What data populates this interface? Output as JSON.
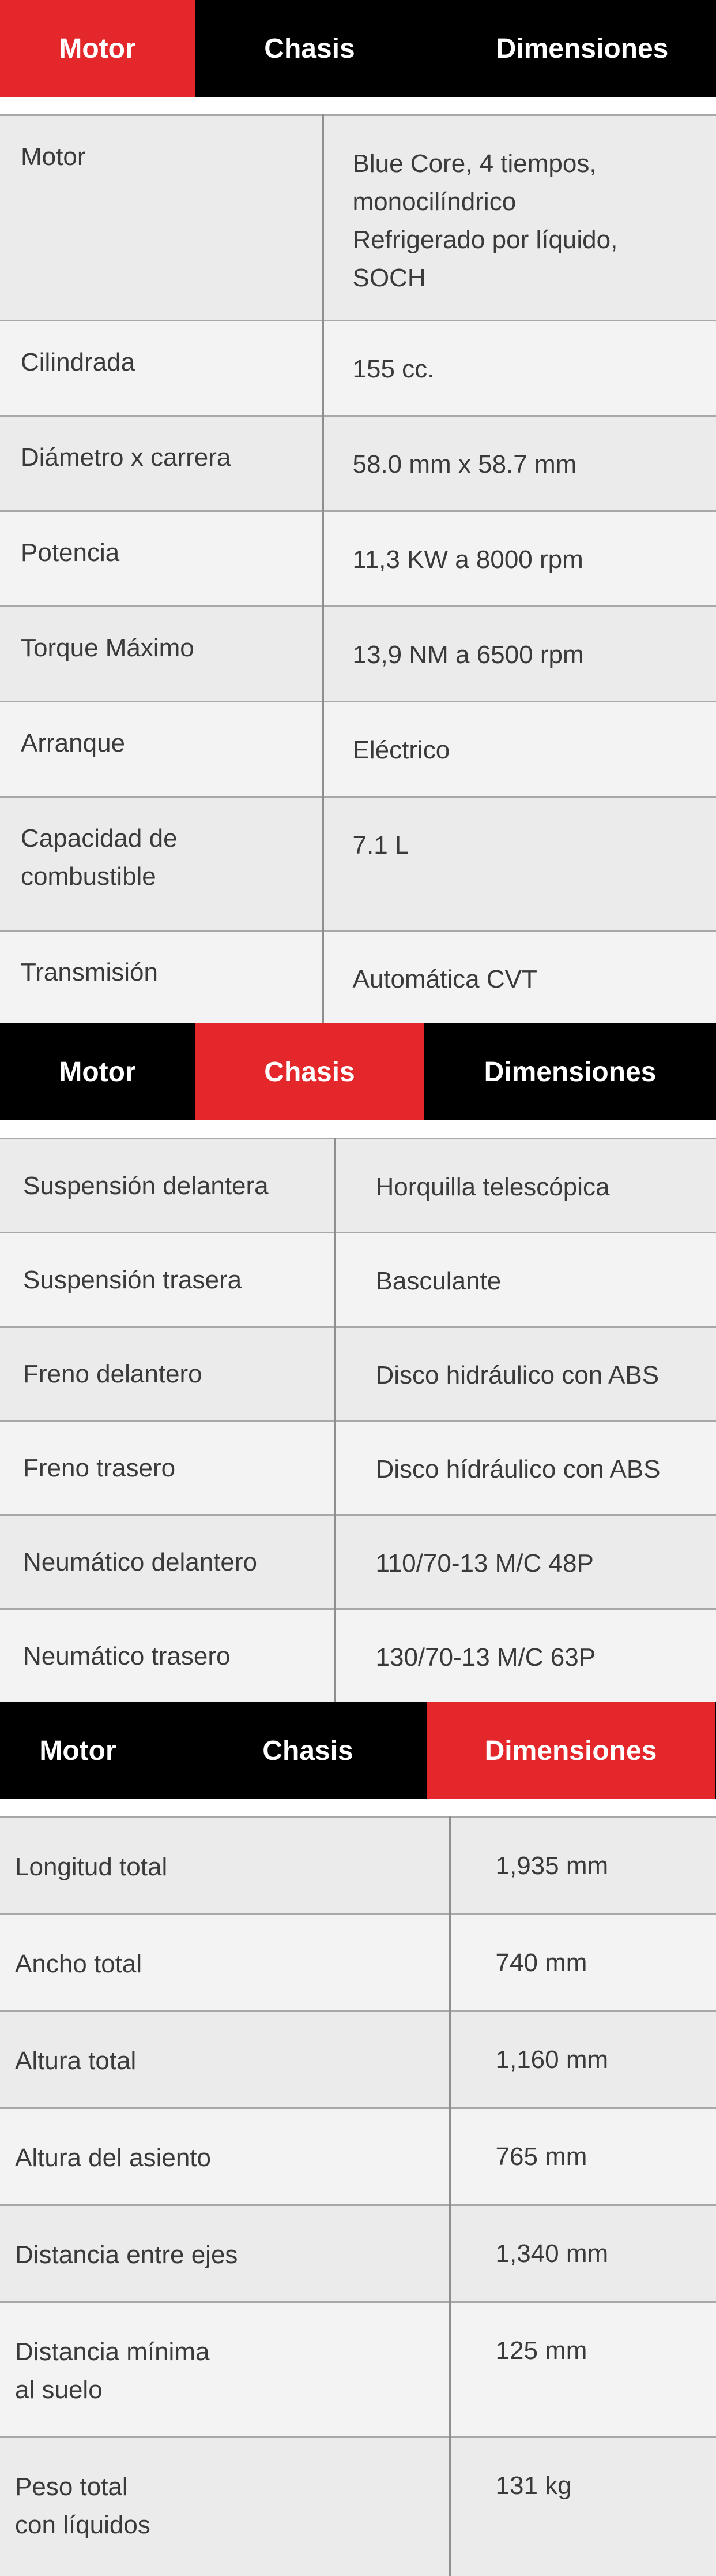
{
  "tabs": [
    "Motor",
    "Chasis",
    "Dimensiones"
  ],
  "sections": {
    "motor": {
      "active_tab": "Motor",
      "rows": [
        {
          "label": "Motor",
          "value": "Blue Core, 4 tiempos,\nmonocilíndrico\nRefrigerado por líquido,\nSOCH"
        },
        {
          "label": "Cilindrada",
          "value": "155 cc."
        },
        {
          "label": "Diámetro x carrera",
          "value": "58.0 mm x 58.7 mm"
        },
        {
          "label": "Potencia",
          "value": "11,3 KW a 8000 rpm"
        },
        {
          "label": "Torque Máximo",
          "value": "13,9 NM a 6500 rpm"
        },
        {
          "label": "Arranque",
          "value": "Eléctrico"
        },
        {
          "label": "Capacidad de\ncombustible",
          "value": "7.1 L"
        },
        {
          "label": "Transmisión",
          "value": "Automática CVT"
        }
      ]
    },
    "chasis": {
      "active_tab": "Chasis",
      "rows": [
        {
          "label": "Suspensión delantera",
          "value": "Horquilla telescópica"
        },
        {
          "label": "Suspensión trasera",
          "value": "Basculante"
        },
        {
          "label": "Freno delantero",
          "value": "Disco hidráulico con ABS"
        },
        {
          "label": "Freno trasero",
          "value": "Disco hídráulico con ABS"
        },
        {
          "label": "Neumático delantero",
          "value": "110/70-13 M/C 48P"
        },
        {
          "label": "Neumático trasero",
          "value": "130/70-13 M/C 63P"
        }
      ]
    },
    "dimensiones": {
      "active_tab": "Dimensiones",
      "rows": [
        {
          "label": "Longitud total",
          "value": "1,935 mm"
        },
        {
          "label": "Ancho total",
          "value": "740 mm"
        },
        {
          "label": "Altura total",
          "value": "1,160 mm"
        },
        {
          "label": "Altura del asiento",
          "value": "765 mm"
        },
        {
          "label": "Distancia entre ejes",
          "value": "1,340 mm"
        },
        {
          "label": "Distancia mínima\nal suelo",
          "value": "125 mm"
        },
        {
          "label": "Peso total\ncon líquidos",
          "value": "131 kg"
        }
      ]
    }
  },
  "colors": {
    "accent": "#e4272b",
    "tabbar": "#000000"
  }
}
